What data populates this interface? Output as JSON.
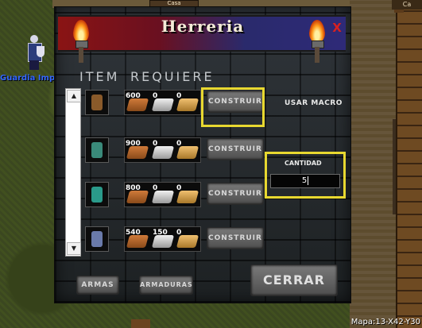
{
  "world": {
    "npc_name": "Guardia Imp",
    "status_text": "Mapa:13-X42-Y30",
    "sign_text": "Casa",
    "sign_right_text": "Ca"
  },
  "window": {
    "title": "Herreria",
    "close_label": "X",
    "col_item": "ITEM",
    "col_requires": "REQUIERE",
    "usar_macro_label": "USAR MACRO",
    "cantidad_label": "CANTIDAD",
    "cantidad_value": "5",
    "armas_label": "ARMAS",
    "armaduras_label": "ARMADURAS",
    "cerrar_label": "CERRAR",
    "rows": [
      {
        "item_icon": "bronze-armor-icon",
        "item_color": "#8a5a2a",
        "req": [
          "600",
          "0",
          "0"
        ],
        "button": "CONSTRUIR"
      },
      {
        "item_icon": "scale-armor-icon",
        "item_color": "#3a8a7a",
        "req": [
          "900",
          "0",
          "0"
        ],
        "button": "CONSTRUIR"
      },
      {
        "item_icon": "green-armor-icon",
        "item_color": "#2a9a8a",
        "req": [
          "800",
          "0",
          "0"
        ],
        "button": "CONSTRUIR"
      },
      {
        "item_icon": "plate-armor-icon",
        "item_color": "#6a7aaa",
        "req": [
          "540",
          "150",
          "0"
        ],
        "button": "CONSTRUIR"
      }
    ]
  }
}
